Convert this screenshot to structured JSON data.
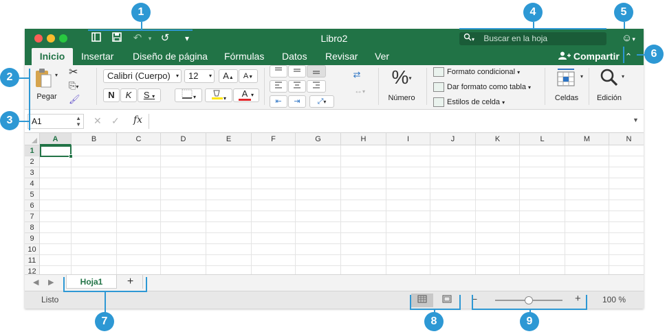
{
  "window": {
    "title": "Libro2",
    "accent_color": "#217346"
  },
  "quick_access": {
    "icons": [
      "sidebar-icon",
      "save-icon",
      "undo-icon",
      "redo-icon",
      "customize-icon"
    ]
  },
  "search": {
    "placeholder": "Buscar en la hoja"
  },
  "tabs": [
    {
      "label": "Inicio",
      "active": true
    },
    {
      "label": "Insertar"
    },
    {
      "label": "Diseño de página"
    },
    {
      "label": "Fórmulas"
    },
    {
      "label": "Datos"
    },
    {
      "label": "Revisar"
    },
    {
      "label": "Ver"
    }
  ],
  "share_label": "Compartir",
  "ribbon": {
    "paste_label": "Pegar",
    "font_name": "Calibri (Cuerpo)",
    "font_size": "12",
    "grow_font": "A",
    "shrink_font": "A",
    "bold": "N",
    "italic": "K",
    "underline": "S",
    "font_color_letter": "A",
    "number_label": "Número",
    "percent_symbol": "%",
    "styles": [
      "Formato condicional",
      "Dar formato como tabla",
      "Estilos de celda"
    ],
    "cells_label": "Celdas",
    "edit_label": "Edición"
  },
  "formula_bar": {
    "name_box": "A1",
    "fx": "fx"
  },
  "grid": {
    "columns": [
      "A",
      "B",
      "C",
      "D",
      "E",
      "F",
      "G",
      "H",
      "I",
      "J",
      "K",
      "L",
      "M",
      "N"
    ],
    "rows": [
      "1",
      "2",
      "3",
      "4",
      "5",
      "6",
      "7",
      "8",
      "9",
      "10",
      "11",
      "12"
    ],
    "selected_cell": "A1"
  },
  "sheets": [
    {
      "name": "Hoja1",
      "active": true
    }
  ],
  "status": {
    "text": "Listo",
    "zoom": "100 %",
    "zoom_fraction": 0.5
  },
  "callouts": [
    "1",
    "2",
    "3",
    "4",
    "5",
    "6",
    "7",
    "8",
    "9"
  ],
  "callout_color": "#2d98d4"
}
